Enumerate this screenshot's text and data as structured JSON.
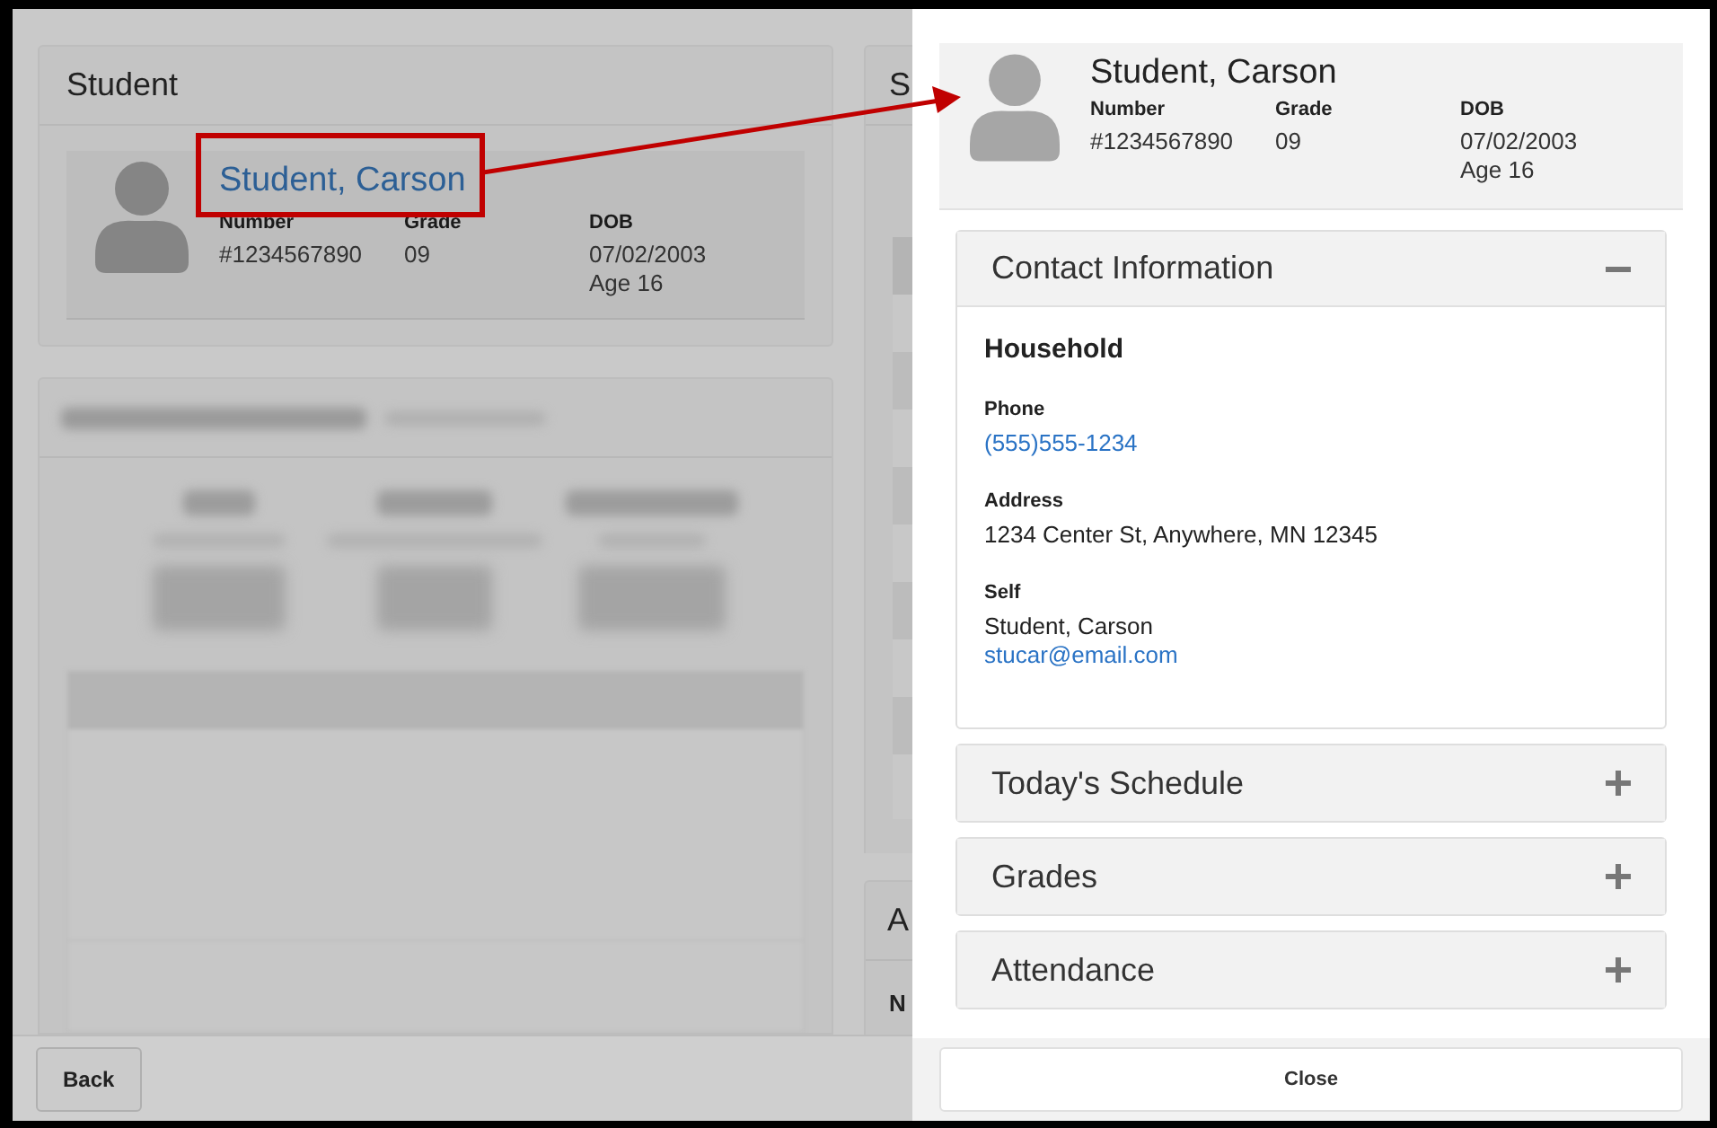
{
  "background": {
    "student_card": {
      "title": "Student",
      "name": "Student, Carson",
      "fields": [
        {
          "label": "Number",
          "value": "#1234567890"
        },
        {
          "label": "Grade",
          "value": "09"
        },
        {
          "label": "DOB",
          "value": "07/02/2003",
          "note": "Age 16"
        }
      ]
    },
    "right_column": {
      "card_titles": [
        "S",
        "A"
      ],
      "label": "N"
    },
    "back_button": "Back"
  },
  "drawer": {
    "header": {
      "name": "Student, Carson",
      "fields": [
        {
          "label": "Number",
          "value": "#1234567890"
        },
        {
          "label": "Grade",
          "value": "09"
        },
        {
          "label": "DOB",
          "value": "07/02/2003",
          "note": "Age 16"
        }
      ]
    },
    "sections": [
      {
        "title": "Contact Information",
        "expanded": true,
        "heading": "Household",
        "items": [
          {
            "label": "Phone",
            "lines": [
              {
                "kind": "link",
                "text": "(555)555-1234"
              }
            ]
          },
          {
            "label": "Address",
            "lines": [
              {
                "kind": "plain",
                "text": "1234 Center St, Anywhere, MN 12345"
              }
            ]
          },
          {
            "label": "Self",
            "lines": [
              {
                "kind": "plain",
                "text": "Student, Carson"
              },
              {
                "kind": "link",
                "text": "stucar@email.com"
              }
            ]
          }
        ]
      },
      {
        "title": "Today's Schedule",
        "expanded": false
      },
      {
        "title": "Grades",
        "expanded": false
      },
      {
        "title": "Attendance",
        "expanded": false
      }
    ],
    "close_button": "Close"
  }
}
